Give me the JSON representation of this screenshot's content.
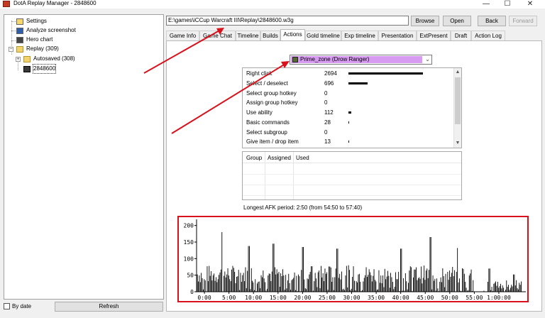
{
  "window": {
    "title": "DotA Replay Manager - 2848600",
    "minimize_glyph": "—",
    "maximize_glyph": "☐",
    "close_glyph": "✕"
  },
  "tree": {
    "items": [
      {
        "label": "Settings",
        "icon": "settings-icon"
      },
      {
        "label": "Analyze screenshot",
        "icon": "monitor-icon"
      },
      {
        "label": "Hero chart",
        "icon": "chart-icon"
      },
      {
        "label": "Replay (309)",
        "icon": "folder-icon",
        "expander": "−"
      },
      {
        "label": "Autosaved (308)",
        "icon": "folder-icon",
        "expander": "+"
      },
      {
        "label": "2848600",
        "icon": "replay-file-icon"
      }
    ]
  },
  "bottom": {
    "by_date_label": "By date",
    "refresh_label": "Refresh"
  },
  "path": {
    "value": "E:\\games\\iCCup Warcraft III\\Replay\\2848600.w3g"
  },
  "buttons": {
    "browse": "Browse",
    "open": "Open",
    "back": "Back",
    "forward": "Forward"
  },
  "tabs": [
    "Game Info",
    "Game Chat",
    "Timeline",
    "Builds",
    "Actions",
    "Gold timeline",
    "Exp timeline",
    "Presentation",
    "ExtPresent",
    "Draft",
    "Action Log"
  ],
  "active_tab": "Actions",
  "player_select": {
    "value": "Prime_zone (Drow Ranger)",
    "highlight_color": "#d79bf1"
  },
  "actions": [
    {
      "label": "Right click",
      "value": "2694",
      "fraction": 1.0
    },
    {
      "label": "Select / deselect",
      "value": "696",
      "fraction": 0.258
    },
    {
      "label": "Select group hotkey",
      "value": "0",
      "fraction": 0
    },
    {
      "label": "Assign group hotkey",
      "value": "0",
      "fraction": 0
    },
    {
      "label": "Use ability",
      "value": "112",
      "fraction": 0.042
    },
    {
      "label": "Basic commands",
      "value": "28",
      "fraction": 0.0104
    },
    {
      "label": "Select subgroup",
      "value": "0",
      "fraction": 0
    },
    {
      "label": "Give item / drop item",
      "value": "13",
      "fraction": 0.005
    }
  ],
  "groups_table": {
    "headers": [
      "Group",
      "Assigned",
      "Used"
    ]
  },
  "afk": {
    "text": "Longest AFK period: 2:50 (from 54:50 to 57:40)"
  },
  "annotation_color": "#d8121c",
  "chart_data": {
    "type": "bar",
    "title": "",
    "xlabel": "",
    "ylabel": "",
    "ylim": [
      0,
      210
    ],
    "yticks": [
      "0",
      "50",
      "100",
      "150",
      "200"
    ],
    "xticks": [
      "0:00",
      "5:00",
      "10:00",
      "15:00",
      "20:00",
      "25:00",
      "30:00",
      "35:00",
      "40:00",
      "45:00",
      "50:00",
      "55:00",
      "1:00:00"
    ],
    "x_range_minutes": [
      -1.6,
      65.5
    ],
    "bar_color": "#000000",
    "x_minutes": [],
    "values": []
  }
}
